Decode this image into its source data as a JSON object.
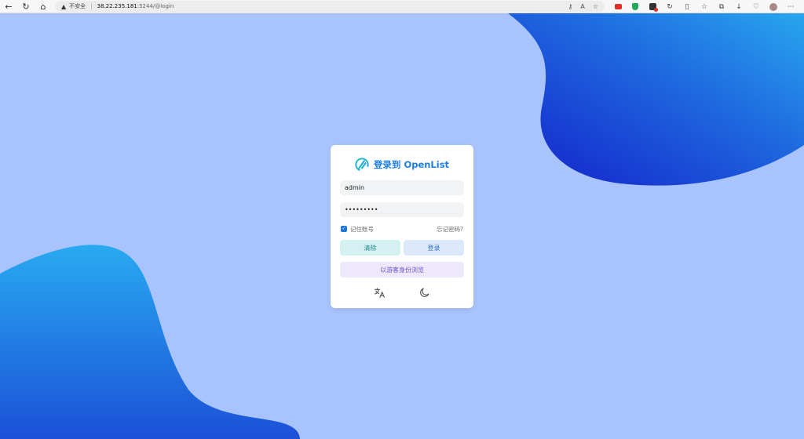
{
  "browser": {
    "security_label": "不安全",
    "url_host": "38.22.235.181",
    "url_path": ":5244/@login"
  },
  "login": {
    "title": "登录到 OpenList",
    "username_value": "admin",
    "password_value": "•••••••••",
    "remember_label": "记住账号",
    "remember_checked": true,
    "forgot_label": "忘记密码?",
    "clear_label": "清除",
    "login_label": "登录",
    "guest_label": "以游客身份浏览"
  },
  "colors": {
    "background": "#a9c4fd",
    "accent": "#1f7ee6",
    "blob_dark": "#1320c8",
    "blob_light": "#28a6ee"
  },
  "icons": {
    "language": "translate-icon",
    "theme": "moon-icon"
  }
}
